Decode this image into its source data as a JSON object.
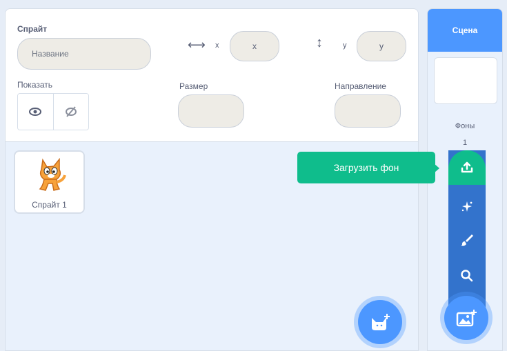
{
  "sprite_info": {
    "sprite_label": "Спрайт",
    "name_placeholder": "Название",
    "x_label": "x",
    "x_placeholder": "x",
    "y_label": "y",
    "y_placeholder": "y",
    "show_label": "Показать",
    "size_label": "Размер",
    "direction_label": "Направление"
  },
  "sprites": [
    {
      "name": "Спрайт 1"
    }
  ],
  "stage": {
    "header": "Сцена",
    "backdrops_label": "Фоны",
    "backdrops_count": "1"
  },
  "backdrop_menu": {
    "tooltip": "Загрузить фон",
    "items": [
      "upload-icon",
      "surprise-icon",
      "paint-icon",
      "search-icon"
    ]
  },
  "colors": {
    "accent": "#4c97ff",
    "menu_dark": "#3373cc",
    "upload_green": "#0fbd8c"
  }
}
